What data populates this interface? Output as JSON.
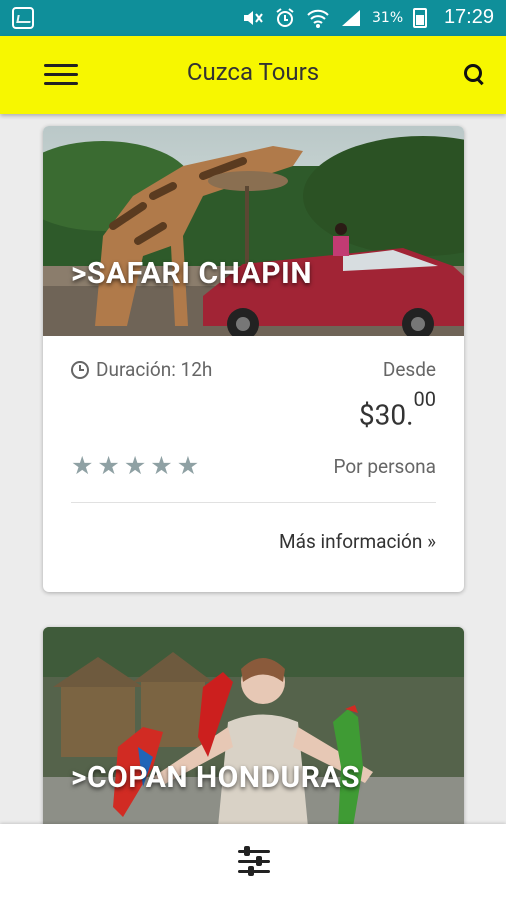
{
  "status_bar": {
    "battery": "31%",
    "time": "17:29",
    "icons": [
      "gallery-icon",
      "mute-icon",
      "alarm-icon",
      "wifi-icon",
      "signal-icon",
      "battery-icon"
    ]
  },
  "app_bar": {
    "title": "Cuzca Tours",
    "menu_icon": "hamburger-menu-icon",
    "search_icon": "search-icon"
  },
  "tours": [
    {
      "title": ">SAFARI CHAPIN",
      "duration": "Duración: 12h",
      "from_label": "Desde",
      "price_main": "$30.",
      "price_cents": "00",
      "rating": 5,
      "per_person": "Por persona",
      "more_info": "Más información »"
    },
    {
      "title": ">COPAN HONDURAS"
    }
  ],
  "bottom_bar": {
    "filter_icon": "filter-sliders-icon"
  },
  "colors": {
    "status_bar": "#0f8f9a",
    "app_bar": "#f7f700",
    "star": "#8fa1a4"
  }
}
